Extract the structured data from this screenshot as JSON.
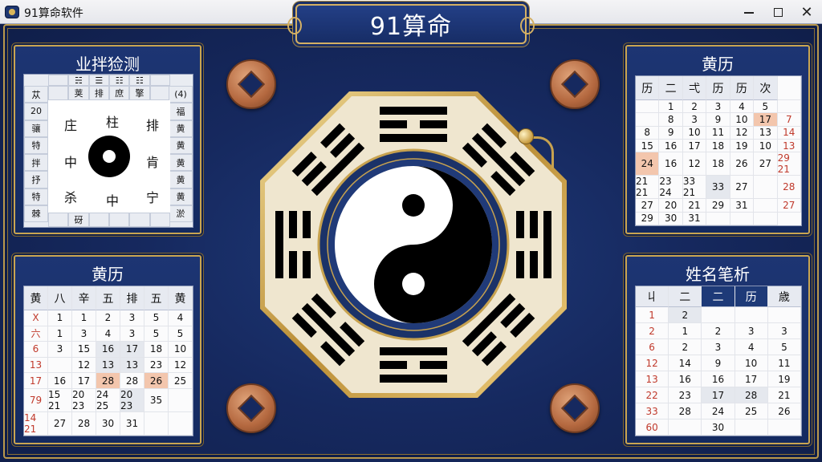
{
  "window": {
    "title": "91算命软件",
    "minimize": "—",
    "maximize": "☐",
    "close": "✕"
  },
  "header": {
    "title": "91算命"
  },
  "panels": {
    "top_left": {
      "title": "业拌猃测",
      "top_row": [
        "",
        "☵",
        "☰",
        "☷",
        "☷",
        ""
      ],
      "row2": [
        "",
        "荚",
        "排",
        "庶",
        "擎",
        ""
      ],
      "left_col": [
        "苁",
        "20",
        "骧",
        "特",
        "拌",
        "抒",
        "特",
        "棘"
      ],
      "right_col": [
        "(4)",
        "福",
        "黄",
        "黄",
        "黄",
        "黄",
        "黄",
        "淤"
      ],
      "bottom_row": [
        "",
        "砑",
        "",
        "",
        "",
        ""
      ],
      "inner": [
        "庄",
        "柱",
        "排",
        "中",
        "肯",
        "杀",
        "中",
        "宁"
      ]
    },
    "top_right": {
      "title": "黄历",
      "headers": [
        "历",
        "二",
        "弌",
        "历",
        "历",
        "次"
      ],
      "rows": [
        [
          "",
          "",
          "1",
          "2",
          "3",
          "4",
          "5"
        ],
        [
          "",
          "",
          "8",
          "3",
          "9",
          "10",
          "17"
        ],
        [
          "7",
          "8",
          "9",
          "10",
          "11",
          "12",
          "13"
        ],
        [
          "14",
          "15",
          "16",
          "17",
          "18",
          "19",
          "10"
        ],
        [
          "13",
          "24",
          "16",
          "12",
          "18",
          "26",
          "27"
        ],
        [
          "29 21",
          "21 21",
          "23 24",
          "33 21",
          "33",
          "27",
          ""
        ],
        [
          "28",
          "27",
          "20",
          "21",
          "29",
          "31",
          ""
        ],
        [
          "27",
          "29",
          "30",
          "31",
          "",
          "",
          ""
        ]
      ]
    },
    "bottom_left": {
      "title": "黄历",
      "headers": [
        "黄",
        "八",
        "辛",
        "五",
        "排",
        "五",
        "黄"
      ],
      "rows": [
        [
          "X",
          "1",
          "1",
          "2",
          "3",
          "5",
          "4"
        ],
        [
          "六",
          "1",
          "3",
          "4",
          "3",
          "5",
          "5"
        ],
        [
          "6",
          "3",
          "15",
          "16",
          "17",
          "18",
          "10"
        ],
        [
          "13",
          "",
          "12",
          "13",
          "13",
          "23",
          "12"
        ],
        [
          "17",
          "16",
          "17",
          "28",
          "28",
          "26",
          "25"
        ],
        [
          "79",
          "15 21",
          "20 23",
          "24 25",
          "20 23",
          "35",
          ""
        ],
        [
          "14 21",
          "27",
          "28",
          "30",
          "31",
          "",
          ""
        ]
      ]
    },
    "bottom_right": {
      "title": "姓名笔析",
      "headers": [
        "丩",
        "二",
        "二",
        "历",
        "歳"
      ],
      "rows": [
        [
          "1",
          "2",
          "",
          "",
          ""
        ],
        [
          "2",
          "1",
          "2",
          "3",
          "3"
        ],
        [
          "6",
          "2",
          "3",
          "4",
          "5"
        ],
        [
          "12",
          "14",
          "9",
          "10",
          "11"
        ],
        [
          "13",
          "16",
          "16",
          "17",
          "19"
        ],
        [
          "22",
          "23",
          "17",
          "28",
          "21"
        ],
        [
          "33",
          "28",
          "24",
          "25",
          "26"
        ],
        [
          "60",
          "",
          "30",
          "",
          ""
        ]
      ]
    }
  },
  "colors": {
    "accent_gold": "#c9a552",
    "navy": "#16295f",
    "highlight": "#f3c6ad"
  }
}
